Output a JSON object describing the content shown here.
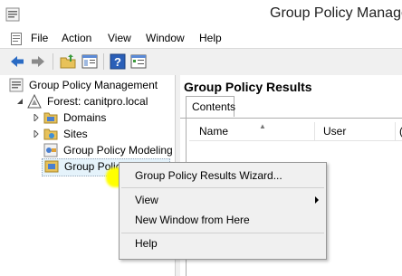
{
  "window": {
    "title": "Group Policy Managem",
    "icon": "gpmc-icon"
  },
  "menu": {
    "items": [
      "File",
      "Action",
      "View",
      "Window",
      "Help"
    ]
  },
  "toolbar": {
    "buttons": [
      "back-arrow-icon",
      "forward-arrow-icon",
      "up-folder-icon",
      "show-hide-tree-icon",
      "help-icon",
      "properties-icon"
    ]
  },
  "tree": {
    "root": "Group Policy Management",
    "forest": "Forest: canitpro.local",
    "domains": "Domains",
    "sites": "Sites",
    "modeling": "Group Policy Modeling",
    "results": "Group Policy Result"
  },
  "right_pane": {
    "title": "Group Policy Results",
    "tab": "Contents",
    "columns": [
      "Name",
      "User",
      "("
    ]
  },
  "context_menu": {
    "items": [
      "Group Policy Results Wizard...",
      "View",
      "New Window from Here",
      "Help"
    ]
  },
  "colors": {
    "highlight": "#ffff00",
    "selection": "#e5f3fb"
  }
}
